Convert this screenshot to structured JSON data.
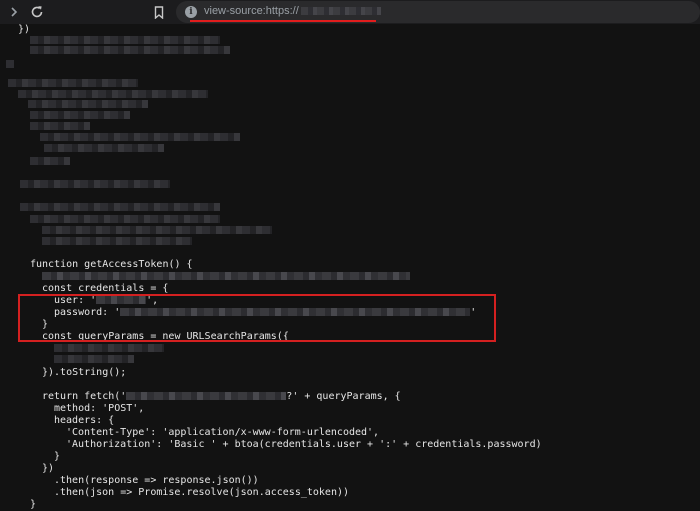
{
  "browser": {
    "url_prefix": "view-source:https://",
    "icons": {
      "back": "chevron-right-icon",
      "reload": "reload-icon",
      "bookmark": "bookmark-icon",
      "info": "info-icon"
    },
    "accent_highlight": "#d42020"
  },
  "code": {
    "top_brace": "})",
    "fn_decl": "function getAccessToken() {",
    "credentials_open": "const credentials = {",
    "user_key": "user: '",
    "user_end": "',",
    "password_key": "password: '",
    "password_end": "'",
    "close_brace": "}",
    "query_params": "const queryParams = new URLSearchParams({",
    "to_string": "}).toString();",
    "fetch_start": "return fetch('",
    "fetch_end": "?' + queryParams, {",
    "method": "method: 'POST',",
    "headers_open": "headers: {",
    "content_type": "'Content-Type': 'application/x-www-form-urlencoded',",
    "authorization": "'Authorization': 'Basic ' + btoa(credentials.user + ':' + credentials.password)",
    "inner_close": "}",
    "fetch_close": "})",
    "then_json": ".then(response => response.json())",
    "then_token": ".then(json => Promise.resolve(json.access_token))",
    "fn_close": "}"
  }
}
